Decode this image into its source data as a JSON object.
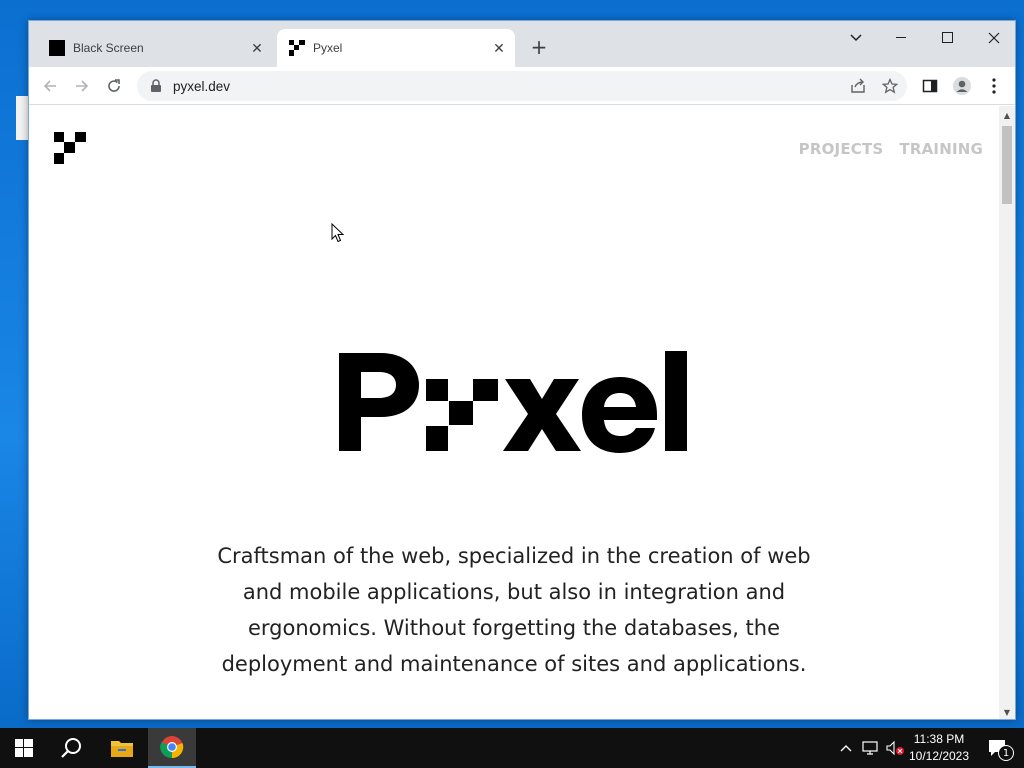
{
  "browser": {
    "tabs": [
      {
        "title": "Black Screen",
        "active": false,
        "favicon": "black-square-icon"
      },
      {
        "title": "Pyxel",
        "active": true,
        "favicon": "pyxel-logo-icon"
      }
    ],
    "url": "pyxel.dev"
  },
  "site": {
    "nav": [
      "PROJECTS",
      "TRAINING"
    ],
    "hero_wordmark": "Pyxel",
    "tagline_lines": [
      "Craftsman of the web, specialized in the creation of web",
      "and mobile applications, but also in integration and",
      "ergonomics. Without forgetting the databases, the",
      "deployment and maintenance of sites and applications."
    ]
  },
  "taskbar": {
    "time": "11:38 PM",
    "date": "10/12/2023",
    "notification_count": "1"
  },
  "colors": {
    "accent": "#0a78d7",
    "nav_text": "#c6c6c6",
    "logo": "#000000"
  }
}
